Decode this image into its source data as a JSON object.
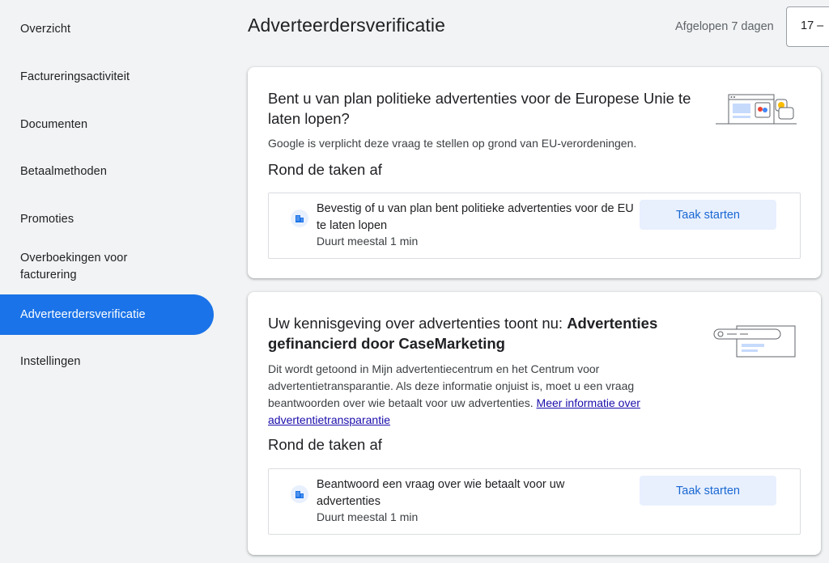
{
  "sidebar": {
    "items": [
      {
        "label": "Overzicht"
      },
      {
        "label": "Factureringsactiviteit"
      },
      {
        "label": "Documenten"
      },
      {
        "label": "Betaalmethoden"
      },
      {
        "label": "Promoties"
      },
      {
        "label": "Overboekingen voor facturering"
      },
      {
        "label": "Adverteerdersverificatie",
        "active": true
      },
      {
        "label": "Instellingen"
      }
    ]
  },
  "header": {
    "title": "Adverteerdersverificatie",
    "period_label": "Afgelopen 7 dagen",
    "date_range": "17 –"
  },
  "cards": [
    {
      "title": "Bent u van plan politieke advertenties voor de Europese Unie te laten lopen?",
      "description": "Google is verplicht deze vraag te stellen op grond van EU-verordeningen.",
      "section_title": "Rond de taken af",
      "task": {
        "title": "Bevestig of u van plan bent politieke advertenties voor de EU te laten lopen",
        "duration": "Duurt meestal 1 min",
        "button": "Taak starten"
      }
    },
    {
      "title_prefix": "Uw kennisgeving over advertenties toont nu: ",
      "title_bold": "Advertenties gefinancierd door CaseMarketing",
      "description": "Dit wordt getoond in Mijn advertentiecentrum en het Centrum voor advertentietransparantie. Als deze informatie onjuist is, moet u een vraag beantwoorden over wie betaalt voor uw advertenties. ",
      "link_text": "Meer informatie over advertentietransparantie",
      "section_title": "Rond de taken af",
      "task": {
        "title": "Beantwoord een vraag over wie betaalt voor uw advertenties",
        "duration": "Duurt meestal 1 min",
        "button": "Taak starten"
      }
    }
  ],
  "icons": {
    "task_icon": "building-icon",
    "card1_illustration": "browser-window-icon",
    "card2_illustration": "search-ad-icon"
  },
  "colors": {
    "accent": "#1a73e8",
    "button_bg": "#e8f0fe",
    "button_text": "#1967d2"
  }
}
